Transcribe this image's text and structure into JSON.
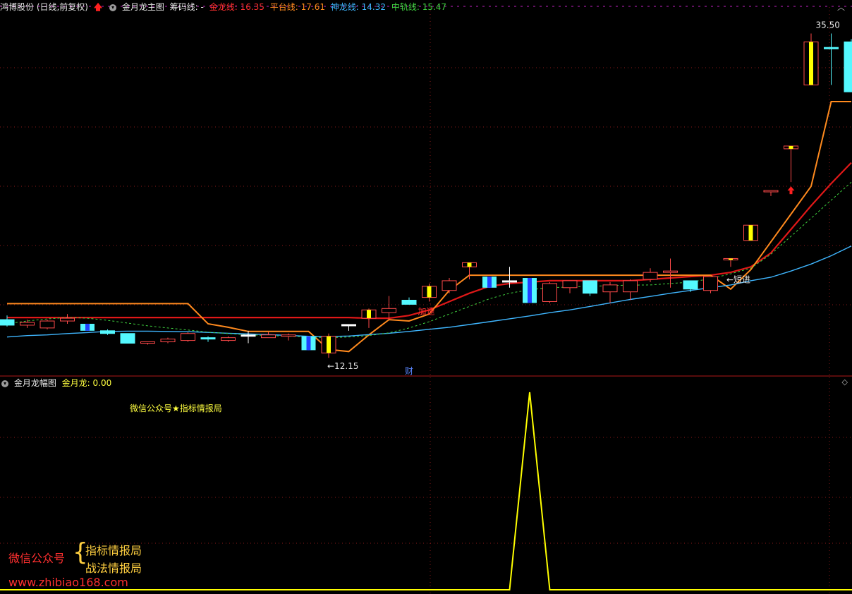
{
  "top_header": {
    "stock_label": "鸿博股份 (日线,前复权)",
    "indicator_name": "金月龙主图",
    "chip_label": "筹码线: -",
    "values": [
      {
        "label": "金龙线: 16.35",
        "color": "#ff3030"
      },
      {
        "label": "平台线: 17.61",
        "color": "#ff8a1e"
      },
      {
        "label": "神龙线: 14.32",
        "color": "#3fb6ff"
      },
      {
        "label": "中轨线: 15.47",
        "color": "#3fd13f"
      }
    ]
  },
  "bottom_header": {
    "indicator_name": "金月龙幅图",
    "value_label": "金月龙: 0.00"
  },
  "watermark_top": "微信公众号★指标情报局",
  "brand": {
    "left": "微信公众号",
    "line1": "指标情报局",
    "line2": "战法情报局",
    "url": "www.zhibiao168.com"
  },
  "chart_data": [
    {
      "type": "candlestick",
      "title": "金月龙主图",
      "ylim": [
        11.5,
        37.0
      ],
      "annotations": [
        {
          "text": "35.50",
          "candle": 41
        },
        {
          "text": "←12.15",
          "candle": 16
        },
        {
          "text": "加速",
          "candle": 21
        },
        {
          "text": "←短进",
          "candle": 36
        },
        {
          "text": "财",
          "candle": 20
        }
      ],
      "candles": [
        {
          "o": 14.9,
          "h": 15.2,
          "l": 14.4,
          "c": 14.5,
          "kind": "cyan"
        },
        {
          "o": 14.7,
          "h": 14.9,
          "l": 14.3,
          "c": 14.5,
          "kind": "red"
        },
        {
          "o": 14.3,
          "h": 14.9,
          "l": 14.2,
          "c": 14.8,
          "kind": "red"
        },
        {
          "o": 14.8,
          "h": 15.3,
          "l": 14.6,
          "c": 15.0,
          "kind": "red"
        },
        {
          "o": 14.6,
          "h": 14.6,
          "l": 14.1,
          "c": 14.1,
          "kind": "blue"
        },
        {
          "o": 14.1,
          "h": 14.2,
          "l": 13.8,
          "c": 13.9,
          "kind": "cyan"
        },
        {
          "o": 13.9,
          "h": 13.9,
          "l": 13.2,
          "c": 13.2,
          "kind": "cyan"
        },
        {
          "o": 13.2,
          "h": 13.3,
          "l": 13.1,
          "c": 13.3,
          "kind": "red"
        },
        {
          "o": 13.3,
          "h": 13.6,
          "l": 13.2,
          "c": 13.5,
          "kind": "red"
        },
        {
          "o": 13.4,
          "h": 14.0,
          "l": 13.3,
          "c": 13.9,
          "kind": "red"
        },
        {
          "o": 13.6,
          "h": 13.7,
          "l": 13.3,
          "c": 13.5,
          "kind": "cyan"
        },
        {
          "o": 13.4,
          "h": 13.7,
          "l": 13.3,
          "c": 13.6,
          "kind": "red"
        },
        {
          "o": 13.8,
          "h": 14.1,
          "l": 13.2,
          "c": 13.8,
          "kind": "white"
        },
        {
          "o": 13.6,
          "h": 14.0,
          "l": 13.6,
          "c": 13.8,
          "kind": "red"
        },
        {
          "o": 13.7,
          "h": 13.9,
          "l": 13.4,
          "c": 13.8,
          "kind": "red"
        },
        {
          "o": 13.7,
          "h": 13.7,
          "l": 12.7,
          "c": 12.7,
          "kind": "blue"
        },
        {
          "o": 12.5,
          "h": 13.9,
          "l": 12.15,
          "c": 13.7,
          "kind": "yellow"
        },
        {
          "o": 14.55,
          "h": 14.55,
          "l": 14.1,
          "c": 14.55,
          "kind": "white"
        },
        {
          "o": 15.0,
          "h": 15.7,
          "l": 14.3,
          "c": 15.6,
          "kind": "yellow"
        },
        {
          "o": 15.4,
          "h": 16.6,
          "l": 14.9,
          "c": 15.7,
          "kind": "red"
        },
        {
          "o": 16.3,
          "h": 16.5,
          "l": 16.0,
          "c": 16.0,
          "kind": "cyan"
        },
        {
          "o": 16.5,
          "h": 17.5,
          "l": 16.2,
          "c": 17.3,
          "kind": "yellow"
        },
        {
          "o": 17.0,
          "h": 17.9,
          "l": 16.8,
          "c": 17.7,
          "kind": "red"
        },
        {
          "o": 18.7,
          "h": 19.0,
          "l": 17.8,
          "c": 19.0,
          "kind": "yellow"
        },
        {
          "o": 18.0,
          "h": 18.0,
          "l": 17.2,
          "c": 17.2,
          "kind": "blue"
        },
        {
          "o": 17.7,
          "h": 18.7,
          "l": 17.2,
          "c": 17.7,
          "kind": "white"
        },
        {
          "o": 17.9,
          "h": 17.9,
          "l": 16.1,
          "c": 16.1,
          "kind": "blue"
        },
        {
          "o": 16.2,
          "h": 17.6,
          "l": 16.1,
          "c": 17.5,
          "kind": "red"
        },
        {
          "o": 17.2,
          "h": 17.7,
          "l": 16.8,
          "c": 17.7,
          "kind": "red"
        },
        {
          "o": 17.7,
          "h": 17.7,
          "l": 16.6,
          "c": 16.8,
          "kind": "cyan"
        },
        {
          "o": 16.9,
          "h": 17.6,
          "l": 16.1,
          "c": 17.4,
          "kind": "red"
        },
        {
          "o": 16.9,
          "h": 17.8,
          "l": 16.3,
          "c": 17.7,
          "kind": "red"
        },
        {
          "o": 17.8,
          "h": 18.6,
          "l": 17.6,
          "c": 18.3,
          "kind": "red"
        },
        {
          "o": 18.3,
          "h": 19.3,
          "l": 17.2,
          "c": 18.4,
          "kind": "red"
        },
        {
          "o": 17.7,
          "h": 17.7,
          "l": 16.9,
          "c": 17.1,
          "kind": "cyan"
        },
        {
          "o": 17.0,
          "h": 18.0,
          "l": 16.8,
          "c": 18.0,
          "kind": "red"
        },
        {
          "o": 19.2,
          "h": 19.3,
          "l": 18.7,
          "c": 19.3,
          "kind": "yellow"
        },
        {
          "o": 20.6,
          "h": 21.7,
          "l": 20.6,
          "c": 21.7,
          "kind": "yellow"
        },
        {
          "o": 24.2,
          "h": 24.2,
          "l": 23.8,
          "c": 24.2,
          "kind": "red"
        },
        {
          "o": 27.2,
          "h": 27.4,
          "l": 24.8,
          "c": 27.4,
          "kind": "yellow"
        },
        {
          "o": 31.8,
          "h": 35.5,
          "l": 31.8,
          "c": 34.9,
          "kind": "yellow"
        },
        {
          "o": 34.5,
          "h": 35.5,
          "l": 31.8,
          "c": 34.5,
          "kind": "cyan"
        },
        {
          "o": 34.9,
          "h": 35.1,
          "l": 31.3,
          "c": 31.3,
          "kind": "cyan"
        }
      ],
      "series": [
        {
          "name": "金龙线",
          "color": "#e01818",
          "values": [
            15.05,
            15.05,
            15.05,
            15.05,
            15.05,
            15.05,
            15.05,
            15.05,
            15.05,
            15.05,
            15.05,
            15.05,
            15.05,
            15.05,
            15.05,
            15.05,
            15.05,
            15.05,
            15.0,
            15.0,
            15.2,
            15.6,
            16.2,
            16.8,
            17.3,
            17.5,
            17.6,
            17.7,
            17.7,
            17.7,
            17.7,
            17.7,
            17.8,
            17.9,
            18.0,
            18.1,
            18.3,
            18.7,
            19.7,
            21.4,
            23.1,
            24.7,
            26.2
          ]
        },
        {
          "name": "平台线",
          "color": "#ff8a1e",
          "values": [
            16.05,
            16.05,
            16.05,
            16.05,
            16.05,
            16.05,
            16.05,
            16.05,
            16.05,
            16.05,
            14.6,
            14.35,
            14.05,
            14.05,
            14.05,
            14.05,
            12.75,
            12.6,
            13.8,
            14.9,
            14.8,
            15.3,
            17.0,
            18.1,
            18.1,
            18.1,
            18.1,
            18.1,
            18.1,
            18.1,
            18.1,
            18.1,
            18.1,
            18.1,
            18.1,
            18.1,
            17.1,
            18.5,
            20.5,
            22.5,
            24.5,
            30.6,
            30.6
          ]
        },
        {
          "name": "神龙线",
          "color": "#3fb6ff",
          "values": [
            13.65,
            13.75,
            13.8,
            13.9,
            13.97,
            14.05,
            14.07,
            14.07,
            14.05,
            14.03,
            13.98,
            13.92,
            13.87,
            13.82,
            13.76,
            13.7,
            13.68,
            13.72,
            13.82,
            13.92,
            14.05,
            14.2,
            14.35,
            14.55,
            14.75,
            14.96,
            15.17,
            15.4,
            15.6,
            15.85,
            16.1,
            16.35,
            16.57,
            16.8,
            17.0,
            17.2,
            17.4,
            17.7,
            17.95,
            18.4,
            18.9,
            19.5,
            20.2
          ]
        },
        {
          "name": "中轨线",
          "color": "#3fd13f",
          "dashed": true,
          "values": [
            14.6,
            14.8,
            14.95,
            15.05,
            15.0,
            14.85,
            14.65,
            14.45,
            14.3,
            14.15,
            14.0,
            13.9,
            13.8,
            13.75,
            13.7,
            13.65,
            13.6,
            13.65,
            13.75,
            13.95,
            14.3,
            14.75,
            15.3,
            15.85,
            16.4,
            16.8,
            17.05,
            17.2,
            17.25,
            17.3,
            17.35,
            17.38,
            17.4,
            17.5,
            17.6,
            17.85,
            18.2,
            18.6,
            19.6,
            20.9,
            22.2,
            23.5,
            24.8
          ]
        }
      ]
    },
    {
      "type": "line",
      "title": "金月龙幅图",
      "ylim": [
        0,
        100
      ],
      "series": [
        {
          "name": "金月龙",
          "color": "#ffff00",
          "values": [
            0,
            0,
            0,
            0,
            0,
            0,
            0,
            0,
            0,
            0,
            0,
            0,
            0,
            0,
            0,
            0,
            0,
            0,
            0,
            0,
            0,
            0,
            0,
            0,
            0,
            0,
            100,
            0,
            0,
            0,
            0,
            0,
            0,
            0,
            0,
            0,
            0,
            0,
            0,
            0,
            0,
            0,
            0
          ]
        }
      ]
    }
  ]
}
